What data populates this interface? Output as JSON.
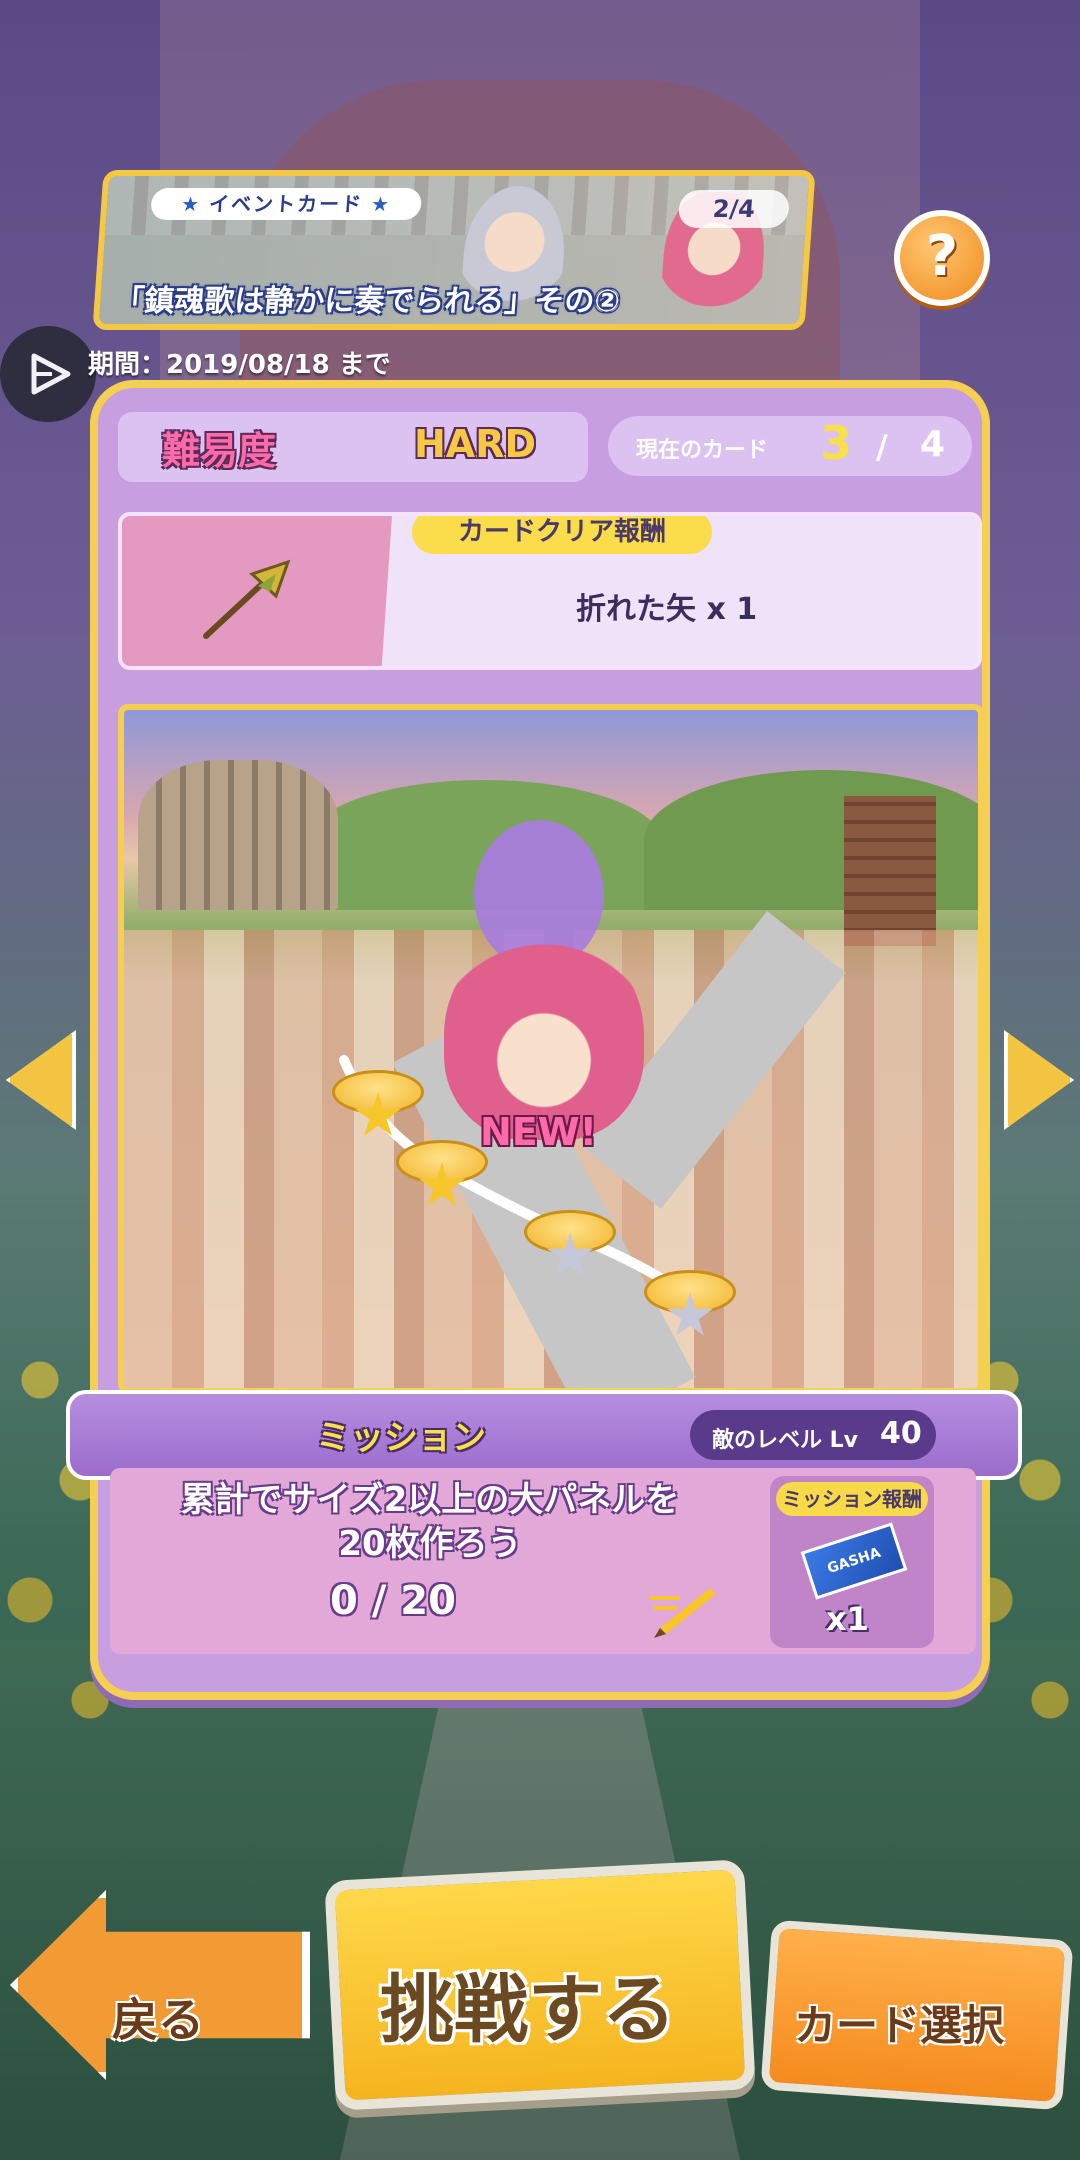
{
  "event": {
    "tag": "イベントカード",
    "title": "「鎮魂歌は静かに奏でられる」その②",
    "page": "2/4",
    "period": "期間：2019/08/18 まで"
  },
  "difficulty": {
    "label": "難易度",
    "value": "HARD"
  },
  "current_card": {
    "label": "現在のカード",
    "current": "3",
    "separator": "/",
    "total": "4"
  },
  "card_clear_reward": {
    "tag": "カードクリア報酬",
    "text": "折れた矢 x 1"
  },
  "stage_map": {
    "new_badge": "NEW!",
    "stages": [
      {
        "star": "gold"
      },
      {
        "star": "gold"
      },
      {
        "star": "silver"
      },
      {
        "star": "silver"
      }
    ]
  },
  "mission": {
    "title": "ミッション",
    "enemy_level_label": "敵のレベル Lv",
    "enemy_level_value": "40",
    "description_line1": "累計でサイズ2以上の大パネルを",
    "description_line2": "20枚作ろう",
    "progress": "0 / 20",
    "reward_tag": "ミッション報酬",
    "reward_ticket": "GASHA",
    "reward_count": "x1"
  },
  "buttons": {
    "back": "戻る",
    "challenge": "挑戦する",
    "card_select": "カード選択"
  },
  "icons": {
    "help": "?",
    "play": "play-icon",
    "arrow_left": "chevron-left-icon",
    "arrow_right": "chevron-right-icon"
  },
  "colors": {
    "panel": "#c79ee0",
    "gold_border": "#f5cf52",
    "accent_yellow": "#f7e04a",
    "accent_pink": "#ff6aa8"
  }
}
